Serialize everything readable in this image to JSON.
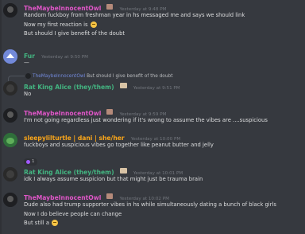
{
  "messages": [
    {
      "username": "TheMaybeInnocentOwl",
      "name_color": "#e056c8",
      "timestamp": "Yesterday at 9:48 PM",
      "lines": [
        "Random fuckboy from freshman year in hs messaged me and says we should link",
        "Now my first reaction is",
        "But should I give benefit of the doubt"
      ]
    },
    {
      "username": "Fur",
      "name_color": "#43b581",
      "timestamp": "Yesterday at 9:50 PM",
      "lines": [
        "—"
      ]
    },
    {
      "reply_to_user": "TheMaybeInnocentOwl",
      "reply_text": "But should I give benefit of the doubt",
      "username": "Rat King Alice (they/them)",
      "name_color": "#43b581",
      "timestamp": "Yesterday at 9:51 PM",
      "lines": [
        "No"
      ]
    },
    {
      "username": "TheMaybeInnocentOwl",
      "name_color": "#e056c8",
      "timestamp": "Yesterday at 9:59 PM",
      "lines": [
        "I'm not going regardless just wondering if it's wrong to assume the vibes are ....suspicious"
      ]
    },
    {
      "username": "sleepylilturtle | dani | she/her",
      "name_color": "#faa61a",
      "timestamp": "Yesterday at 10:00 PM",
      "lines": [
        "fuckboys and suspicious vibes go together like peanut butter and jelly"
      ],
      "reaction_count": "1"
    },
    {
      "username": "Rat King Alice (they/them)",
      "name_color": "#43b581",
      "timestamp": "Yesterday at 10:01 PM",
      "lines": [
        "idk I always assume suspicion but that might just be trauma brain"
      ]
    },
    {
      "username": "TheMaybeInnocentOwl",
      "name_color": "#e056c8",
      "timestamp": "Yesterday at 10:02 PM",
      "lines": [
        "Dude also had trump supporter vibes in hs while simultaneously dating a bunch of black girls",
        "Now I do believe people can change",
        "But still a"
      ]
    }
  ]
}
